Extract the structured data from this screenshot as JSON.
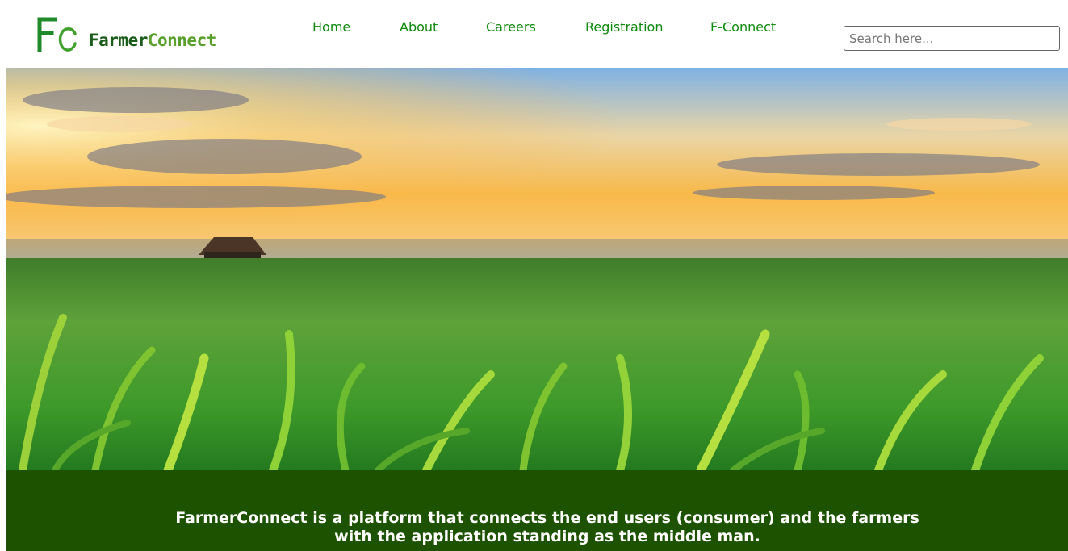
{
  "brand": {
    "name_part1": "Farmer",
    "name_part2": "Connect"
  },
  "nav": {
    "items": [
      {
        "label": "Home"
      },
      {
        "label": "About"
      },
      {
        "label": "Careers"
      },
      {
        "label": "Registration"
      },
      {
        "label": "F-Connect"
      }
    ]
  },
  "search": {
    "placeholder": "Search here..."
  },
  "hero": {
    "alt": "Corn field at sunset"
  },
  "banner": {
    "line1": "FarmerConnect is a platform that connects the end users (consumer) and the farmers",
    "line2": "with the application standing as the middle man."
  },
  "colors": {
    "brand_green": "#0e8a0e",
    "banner_bg": "#1d5200"
  }
}
